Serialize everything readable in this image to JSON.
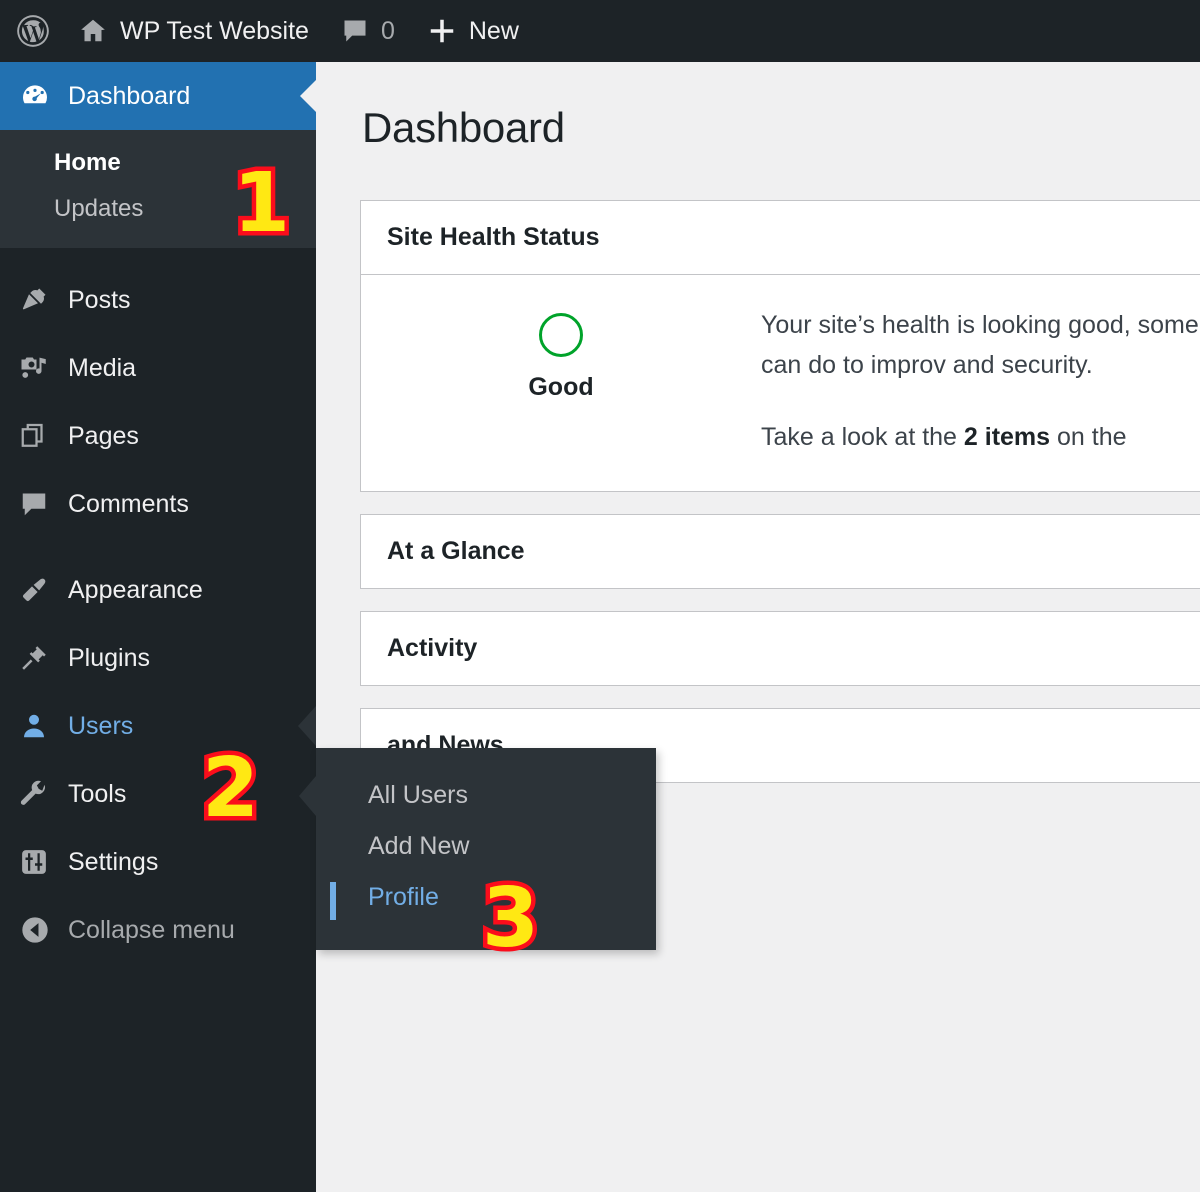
{
  "adminbar": {
    "wp_logo_icon": "wordpress-logo-icon",
    "home_icon": "home-icon",
    "site_name": "WP Test Website",
    "comments_icon": "comment-bubble-icon",
    "comments_count": "0",
    "new_plus_icon": "plus-icon",
    "new_label": "New"
  },
  "sidebar": {
    "items": [
      {
        "label": "Dashboard",
        "icon": "dashboard-gauge-icon",
        "state": "current"
      },
      {
        "label": "Posts",
        "icon": "pushpin-icon",
        "state": "normal"
      },
      {
        "label": "Media",
        "icon": "camera-music-icon",
        "state": "normal"
      },
      {
        "label": "Pages",
        "icon": "pages-stack-icon",
        "state": "normal"
      },
      {
        "label": "Comments",
        "icon": "comment-bubble-icon",
        "state": "normal"
      },
      {
        "label": "Appearance",
        "icon": "paintbrush-icon",
        "state": "normal"
      },
      {
        "label": "Plugins",
        "icon": "plug-icon",
        "state": "normal"
      },
      {
        "label": "Users",
        "icon": "user-icon",
        "state": "hovered"
      },
      {
        "label": "Tools",
        "icon": "wrench-icon",
        "state": "normal"
      },
      {
        "label": "Settings",
        "icon": "sliders-icon",
        "state": "normal"
      },
      {
        "label": "Collapse menu",
        "icon": "arrow-left-circle-icon",
        "state": "dim"
      }
    ],
    "dashboard_submenu": [
      {
        "label": "Home",
        "active": true
      },
      {
        "label": "Updates",
        "active": false
      }
    ]
  },
  "flyout": {
    "items": [
      {
        "label": "All Users",
        "current": false
      },
      {
        "label": "Add New",
        "current": false
      },
      {
        "label": "Profile",
        "current": true
      }
    ]
  },
  "main": {
    "page_title": "Dashboard",
    "panels": [
      {
        "title": "Site Health Status"
      },
      {
        "title": "At a Glance"
      },
      {
        "title": "Activity"
      },
      {
        "title": "and News"
      }
    ],
    "site_health": {
      "gauge_label": "Good",
      "paragraph_1_pre": "Your site’s health is looking good,",
      "paragraph_1_mid": "some things you can do to improv",
      "paragraph_1_end": "and security.",
      "paragraph_2_pre": "Take a look at the ",
      "paragraph_2_bold": "2 items",
      "paragraph_2_post": " on the"
    }
  },
  "badges": {
    "one": "1",
    "two": "2",
    "three": "3"
  },
  "colors": {
    "admin_dark": "#1d2327",
    "submenu_dark": "#2c3338",
    "active_blue": "#2271b1",
    "link_blue": "#72aee6",
    "page_bg": "#f0f0f1",
    "panel_border": "#c3c4c7",
    "health_green": "#00a32a",
    "badge_fill": "#ffe813",
    "badge_stroke": "#fb0d1b"
  }
}
